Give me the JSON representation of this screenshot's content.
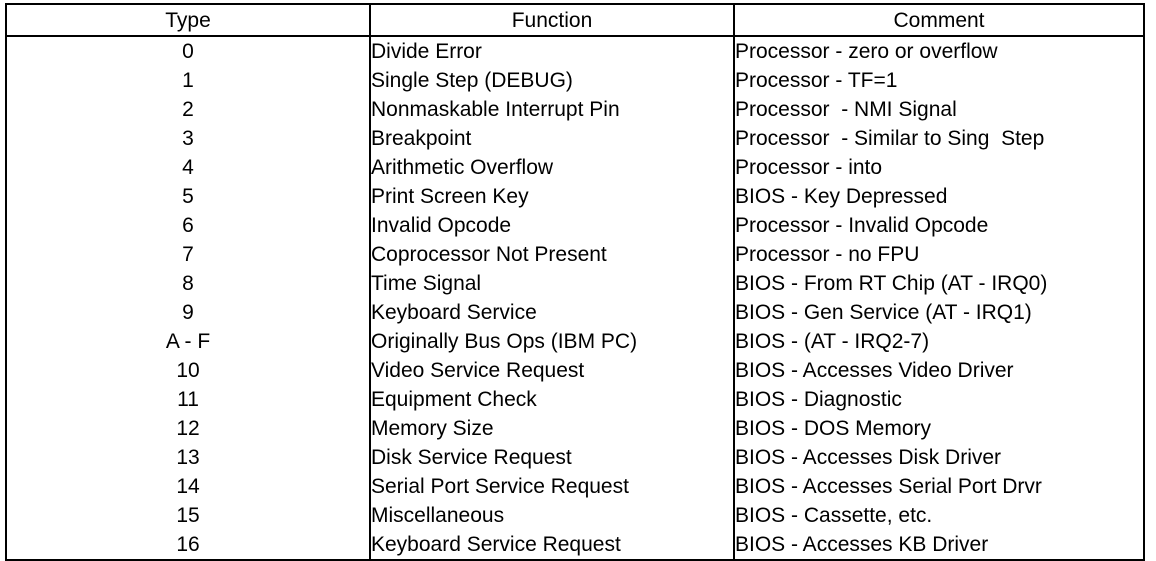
{
  "table": {
    "name": "interrupt-vector-table",
    "columns": [
      {
        "key": "type",
        "label": "Type",
        "align": "center"
      },
      {
        "key": "function",
        "label": "Function",
        "align": "left"
      },
      {
        "key": "comment",
        "label": "Comment",
        "align": "left"
      }
    ],
    "rows": [
      {
        "type": "0",
        "function": "Divide Error",
        "comment": "Processor - zero or overflow"
      },
      {
        "type": "1",
        "function": "Single Step (DEBUG)",
        "comment": "Processor - TF=1"
      },
      {
        "type": "2",
        "function": "Nonmaskable Interrupt Pin",
        "comment": "Processor  - NMI Signal"
      },
      {
        "type": "3",
        "function": "Breakpoint",
        "comment": "Processor  - Similar to Sing  Step"
      },
      {
        "type": "4",
        "function": "Arithmetic Overflow",
        "comment": "Processor - into"
      },
      {
        "type": "5",
        "function": "Print Screen Key",
        "comment": "BIOS - Key Depressed"
      },
      {
        "type": "6",
        "function": "Invalid Opcode",
        "comment": "Processor - Invalid Opcode"
      },
      {
        "type": "7",
        "function": "Coprocessor Not Present",
        "comment": "Processor - no FPU"
      },
      {
        "type": "8",
        "function": "Time Signal",
        "comment": "BIOS - From RT Chip (AT - IRQ0)"
      },
      {
        "type": "9",
        "function": "Keyboard Service",
        "comment": "BIOS - Gen Service (AT - IRQ1)"
      },
      {
        "type": "A - F",
        "function": "Originally Bus Ops (IBM PC)",
        "comment": "BIOS - (AT - IRQ2-7)"
      },
      {
        "type": "10",
        "function": "Video Service Request",
        "comment": "BIOS - Accesses Video Driver"
      },
      {
        "type": "11",
        "function": "Equipment Check",
        "comment": "BIOS - Diagnostic"
      },
      {
        "type": "12",
        "function": "Memory Size",
        "comment": "BIOS - DOS Memory"
      },
      {
        "type": "13",
        "function": "Disk Service Request",
        "comment": "BIOS - Accesses Disk Driver"
      },
      {
        "type": "14",
        "function": "Serial Port Service Request",
        "comment": "BIOS - Accesses Serial Port Drvr"
      },
      {
        "type": "15",
        "function": "Miscellaneous",
        "comment": "BIOS - Cassette, etc."
      },
      {
        "type": "16",
        "function": "Keyboard Service Request",
        "comment": "BIOS - Accesses KB Driver"
      }
    ]
  },
  "style": {
    "border_color": "#000000",
    "background_color": "#ffffff",
    "text_color": "#000000"
  }
}
